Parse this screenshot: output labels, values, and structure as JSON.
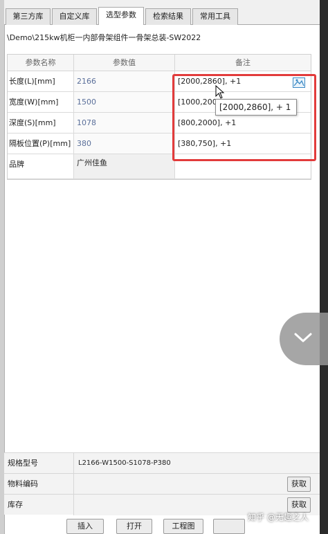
{
  "tabs": [
    "第三方库",
    "自定义库",
    "选型参数",
    "检索结果",
    "常用工具"
  ],
  "path": "\\Demo\\215kw机柜一内部骨架组件一骨架总装-SW2022",
  "table": {
    "headers": [
      "参数名称",
      "参数值",
      "备注"
    ],
    "rows": [
      {
        "name": "长度(L)[mm]",
        "value": "2166",
        "note": "[2000,2860], +1"
      },
      {
        "name": "宽度(W)[mm]",
        "value": "1500",
        "note": "[1000,2000"
      },
      {
        "name": "深度(S)[mm]",
        "value": "1078",
        "note": "[800,2000], +1"
      },
      {
        "name": "隔板位置(P)[mm]",
        "value": "380",
        "note": "[380,750], +1"
      },
      {
        "name": "品牌",
        "value": "广州佳鱼",
        "note": ""
      }
    ]
  },
  "tooltip": "[2000,2860], + 1",
  "bottom": {
    "model_label": "规格型号",
    "model_value": "L2166-W1500-S1078-P380",
    "material_label": "物料编码",
    "stock_label": "库存",
    "fetch_label": "获取"
  },
  "actions": [
    "插入",
    "打开",
    "工程图"
  ],
  "watermark": "知乎 @无趣之人",
  "colors": {
    "highlight": "#e23b3b",
    "value_text": "#5a6f9a"
  }
}
